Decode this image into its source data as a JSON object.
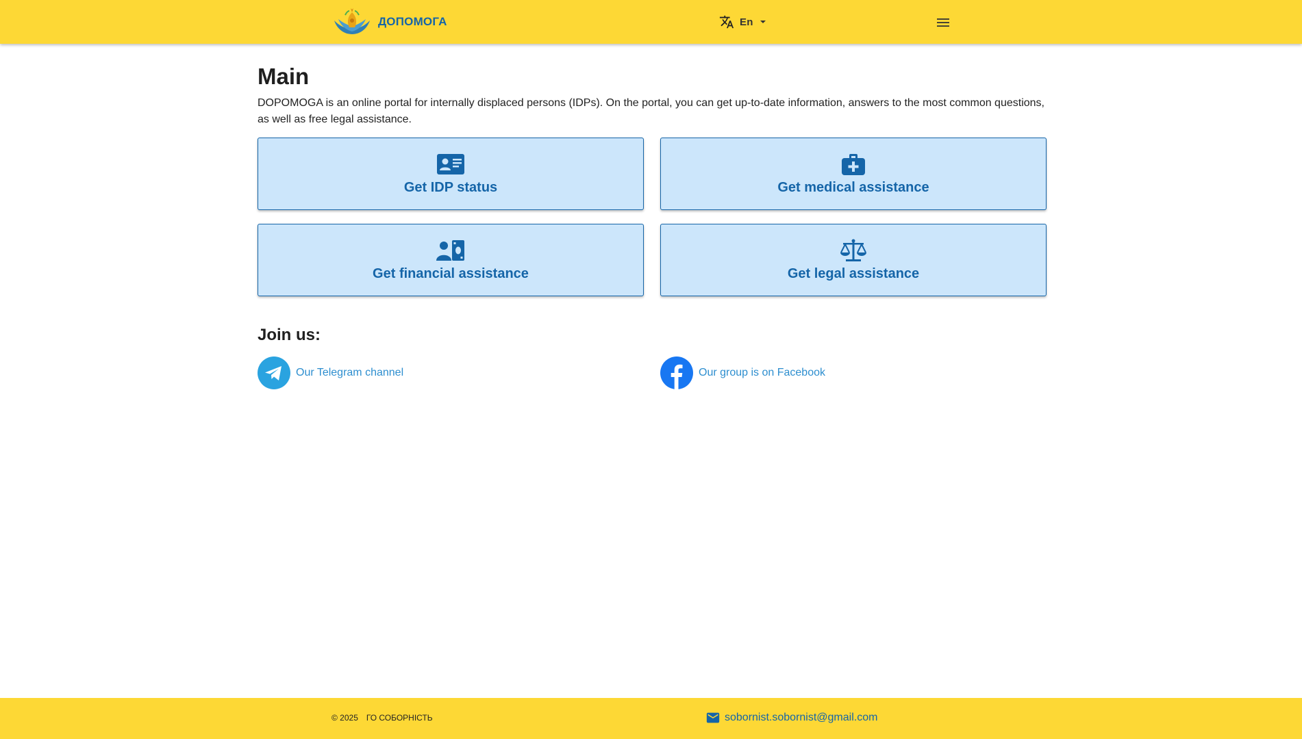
{
  "header": {
    "brand_name": "ДОПОМОГА",
    "language": "En",
    "icons": {
      "logo": "dopomoga-logo",
      "language": "translate-icon",
      "language_caret": "caret-down-icon",
      "menu": "hamburger-menu-icon"
    }
  },
  "main": {
    "title": "Main",
    "intro": "DOPOMOGA is an online portal for internally displaced persons (IDPs). On the portal, you can get up-to-date information, answers to the most common questions, as well as free legal assistance.",
    "cards": [
      {
        "label": "Get IDP status",
        "icon": "id-card-icon"
      },
      {
        "label": "Get medical assistance",
        "icon": "medical-bag-icon"
      },
      {
        "label": "Get financial assistance",
        "icon": "person-money-icon"
      },
      {
        "label": "Get legal assistance",
        "icon": "scales-icon"
      }
    ],
    "join_title": "Join us:",
    "social": [
      {
        "label": "Our Telegram channel",
        "icon": "telegram-icon"
      },
      {
        "label": "Our group is on Facebook",
        "icon": "facebook-icon"
      }
    ]
  },
  "footer": {
    "copyright": "© 2025",
    "organization": "ГО СОБОРНІСТЬ",
    "email": "sobornist.sobornist@gmail.com",
    "email_icon": "mail-icon"
  },
  "colors": {
    "header_bg": "#fdd835",
    "card_bg": "#cce6fb",
    "accent_blue": "#1565a8",
    "link_blue": "#2d8ecf",
    "telegram": "#2aa3e0",
    "facebook": "#1877f2"
  }
}
